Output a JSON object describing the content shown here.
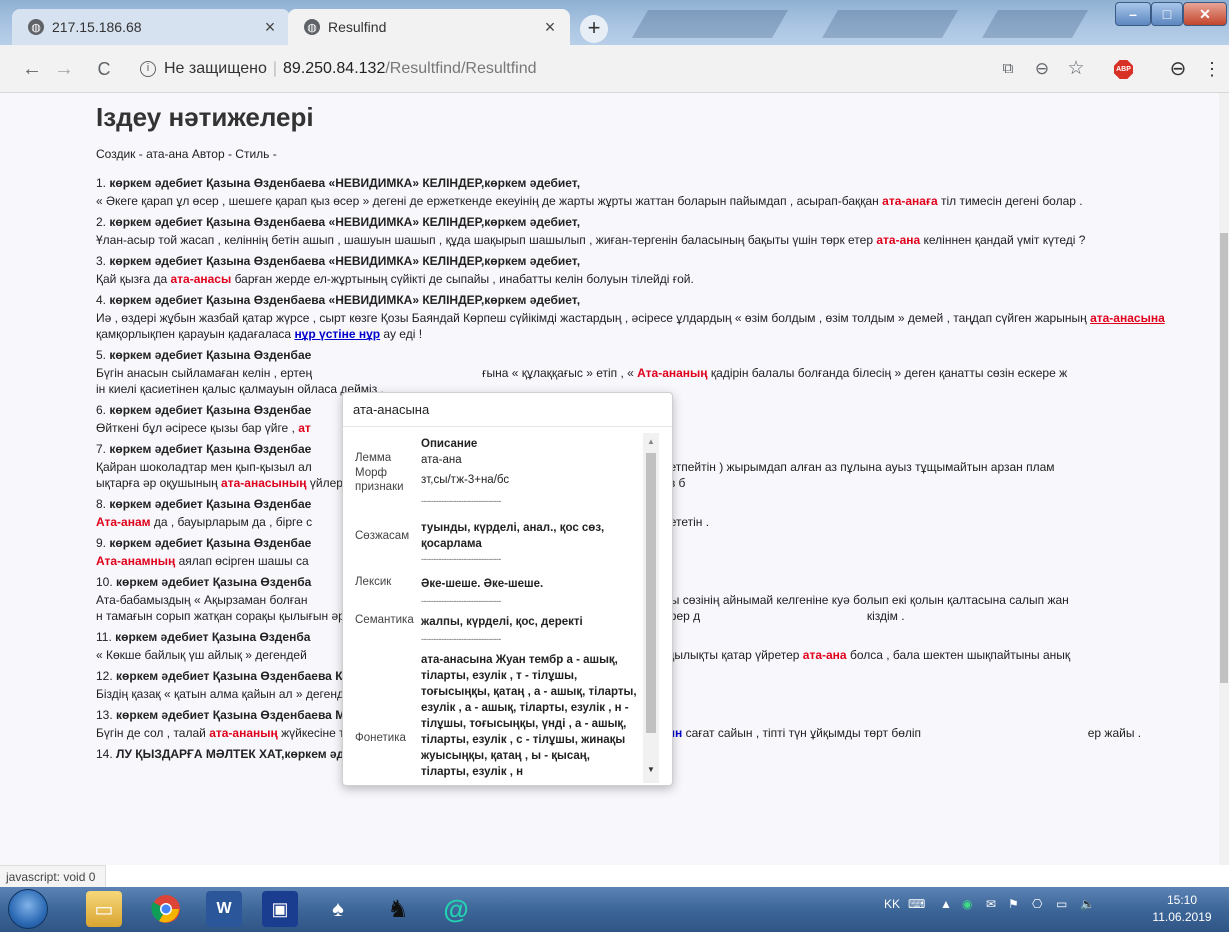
{
  "browser": {
    "tabs": [
      {
        "title": "217.15.186.68",
        "active": false
      },
      {
        "title": "Resulfind",
        "active": true
      }
    ],
    "new_tab_label": "+",
    "window_controls": {
      "minimize": "–",
      "maximize": "□",
      "close": "✕"
    },
    "nav": {
      "back": "←",
      "forward": "→",
      "reload": "C"
    },
    "address": {
      "security": "Не защищено",
      "host": "89.250.84.132",
      "path": "/Resultfind/Resultfind"
    },
    "toolbar_icons": [
      "translate-icon",
      "zoom-icon",
      "bookmark-star-icon",
      "adblock-icon",
      "profile-icon",
      "menu-icon"
    ],
    "abp_label": "ABP"
  },
  "page": {
    "heading": "Іздеу нәтижелері",
    "meta": "Создик - ата-ана Автор - Стиль -",
    "results": [
      {
        "num": "1.",
        "title": "көркем әдебиет Қазына Өзденбаева «НЕВИДИМКА» КЕЛІНДЕР,көркем әдебиет,",
        "parts": [
          [
            "t",
            "« Әкеге қарап ұл өсер , шешеге қарап қыз өсер » дегені де ержеткенде екеуінің де жарты жұрты жаттан боларын пайымдап , асырап-баққан "
          ],
          [
            "r",
            "ата-анаға"
          ],
          [
            "t",
            " тіл тимесін дегені болар ."
          ]
        ]
      },
      {
        "num": "2.",
        "title": "көркем әдебиет Қазына Өзденбаева «НЕВИДИМКА» КЕЛІНДЕР,көркем әдебиет,",
        "parts": [
          [
            "t",
            "Ұлан-асыр той жасап , келіннің бетін ашып , шашуын шашып , құда шақырып шашылып , жиған-тергенін баласының бақыты үшін төрк етер "
          ],
          [
            "r",
            "ата-ана"
          ],
          [
            "t",
            " келіннен қандай үміт күтеді ?"
          ]
        ]
      },
      {
        "num": "3.",
        "title": "көркем әдебиет Қазына Өзденбаева «НЕВИДИМКА» КЕЛІНДЕР,көркем әдебиет,",
        "parts": [
          [
            "t",
            "Қай қызға да "
          ],
          [
            "r",
            "ата-анасы"
          ],
          [
            "t",
            " барған жерде ел-жұртының сүйікті де сыпайы , инабатты келін болуын тілейді ғой."
          ]
        ]
      },
      {
        "num": "4.",
        "title": "көркем әдебиет Қазына Өзденбаева «НЕВИДИМКА» КЕЛІНДЕР,көркем әдебиет,",
        "parts": [
          [
            "t",
            "Иә , өздері жұбын жазбай қатар жүрсе , сырт көзге Қозы Баяндай Көрпеш сүйікімді жастардың , әсіресе ұлдардың « өзім болдым , өзім толдым » демей , таңдап сүйген жарының "
          ],
          [
            "ru",
            "ата-анасына"
          ],
          [
            "t",
            " қамқорлықпен қарауын қадағаласа "
          ],
          [
            "bu",
            "нұр үстіне нұр"
          ],
          [
            "t",
            " ау еді !"
          ]
        ]
      },
      {
        "num": "5.",
        "title": "көркем әдебиет Қазына Өзденбае",
        "parts": [
          [
            "t",
            "Бүгін анасын сыйламаған келін , ертең                                                   ғына « құлаққағыс » етіп , « "
          ],
          [
            "r",
            "Ата-ананың"
          ],
          [
            "t",
            " қадірін балалы болғанда білесің » деген қанатты сөзін ескере ж                                                    ін киелі қасиетінен қалыс қалмауын ойласа дейміз ."
          ]
        ]
      },
      {
        "num": "6.",
        "title": "көркем әдебиет Қазына Өзденбае",
        "parts": [
          [
            "t",
            "Өйткені бұл әсіресе қызы бар үйге , "
          ],
          [
            "r",
            "ат"
          ]
        ]
      },
      {
        "num": "7.",
        "title": "көркем әдебиет Қазына Өзденбае",
        "parts": [
          [
            "t",
            "Қайран шоколадтар мен қып-қызыл ал                                                 ан жиып жасаған қорынан ( өмірі жетпейтін ) жырымдап алған аз пұлына ауыз тұщымайтын арзан плам                                               ықтарға әр оқушының "
          ],
          [
            "r",
            "ата-анасының"
          ],
          [
            "t",
            " үйлерінен дайындап берген қалтаға салынған сыйлығын өнерпаз б"
          ]
        ]
      },
      {
        "num": "8.",
        "title": "көркем әдебиет Қазына Өзденбае",
        "parts": [
          [
            "r",
            "Ата-анам"
          ],
          [
            "t",
            " да , бауырларым да , бірге с                                                  ұзын әрі қалың шашымды мақтан ететін ."
          ]
        ]
      },
      {
        "num": "9.",
        "title": "көркем әдебиет Қазына Өзденбае",
        "parts": [
          [
            "r",
            "Ата-анамның"
          ],
          [
            "t",
            " аялап өсірген шашы са"
          ]
        ]
      },
      {
        "num": "10.",
        "title": "көркем әдебиет Қазына Өзденба",
        "parts": [
          [
            "t",
            "Ата-бабамыздың « Ақырзаман болған                                                  ы » деген жүздеген жылдар бұрынғы сөзінің айнымай келгеніне куә болып екі қолын қалтасына салып жан                                                  н тамағын сорып жатқан сорақы қылығын әрбір "
          ],
          [
            "r",
            "ата-ана"
          ],
          [
            "t",
            " өз қызы екен деп сезініп , санасына сәуле түсірер д                                                  кіздім ."
          ]
        ]
      },
      {
        "num": "11.",
        "title": "көркем әдебиет Қазына Өзденба",
        "parts": [
          [
            "t",
            "« Көкше байлық үш айлық » дегендей                                                  алаларына адамгершілік пен имандылықты қатар үйретер "
          ],
          [
            "r",
            "ата-ана"
          ],
          [
            "t",
            " болса , бала шектен шықпайтыны анық"
          ]
        ]
      },
      {
        "num": "12.",
        "title": "көркем әдебиет Қазына Өзденбаева КҮЙЕУ ЖҰМСАҒЫШ КЕЛІН,көркем әдебиет,",
        "parts": [
          [
            "t",
            "Біздің қазақ « қатын алма қайын ал » дегенде , шыққан тегіне , "
          ],
          [
            "r",
            "ата-анасына"
          ],
          [
            "t",
            " қарап ал деген ау екен ."
          ]
        ]
      },
      {
        "num": "13.",
        "title": "көркем әдебиет Қазына Өзденбаева МЫЛҚАУ ҚЫЗДАРҒА МӘЛТЕК ХАТ,көркем әдебиет,",
        "parts": [
          [
            "t",
            "Бүгін де сол , талай "
          ],
          [
            "r",
            "ата-ананың"
          ],
          [
            "t",
            " жүйкесіне тиіп , ашуын келтірер « мылқау қыздар » менің де "
          ],
          [
            "b",
            "күн сайын"
          ],
          [
            "t",
            " сағат сайын , тіпті түн ұйқымды төрт бөліп                                                  ер жайы ."
          ]
        ]
      },
      {
        "num": "14.",
        "title": "                                                   ЛУ ҚЫЗДАРҒА МӘЛТЕК ХАТ,көркем әдебиет,",
        "parts": []
      }
    ]
  },
  "popup": {
    "header": "ата-анасына",
    "column_title": "Описание",
    "divider": "--------------------------------",
    "rows": [
      {
        "label": "Лемма",
        "value": "ата-ана",
        "bold": false
      },
      {
        "label": "Морф признаки",
        "value": "зт,сы/тж-3+на/бс",
        "bold": false
      },
      {
        "label": "Сөзжасам",
        "value": "туынды, күрделі, анал., қос сөз, қосарлама",
        "bold": true
      },
      {
        "label": "Лексик",
        "value": "Әке-шеше. Әке-шеше.",
        "bold": true
      },
      {
        "label": "Семантика",
        "value": "жалпы, күрделі, қос, деректі",
        "bold": true
      },
      {
        "label": "Фонетика",
        "value": "ата-анасына Жуан тембр а - ашық, тіларты, езулік , т - тілұшы, тоғысыңқы, қатаң , а - ашық, тіларты, езулік , а - ашық, тіларты, езулік , н - тілұшы, тоғысыңқы, үнді , а - ашық, тіларты, езулік , с - тілұшы, жинақы жуысыңқы, қатаң , ы - қысаң, тіларты, езулік , н",
        "bold": true
      }
    ]
  },
  "status_bubble": "javascript: void 0",
  "taskbar": {
    "apps": [
      "explorer-icon",
      "chrome-icon",
      "word-icon",
      "save-icon",
      "solitaire-icon",
      "chess-icon",
      "at-sign-icon"
    ],
    "tray_lang": "KK",
    "time": "15:10",
    "date": "11.06.2019"
  },
  "colors": {
    "highlight_red": "#e0001b",
    "highlight_blue": "#0000cc",
    "taskbar": "#3d6699"
  }
}
